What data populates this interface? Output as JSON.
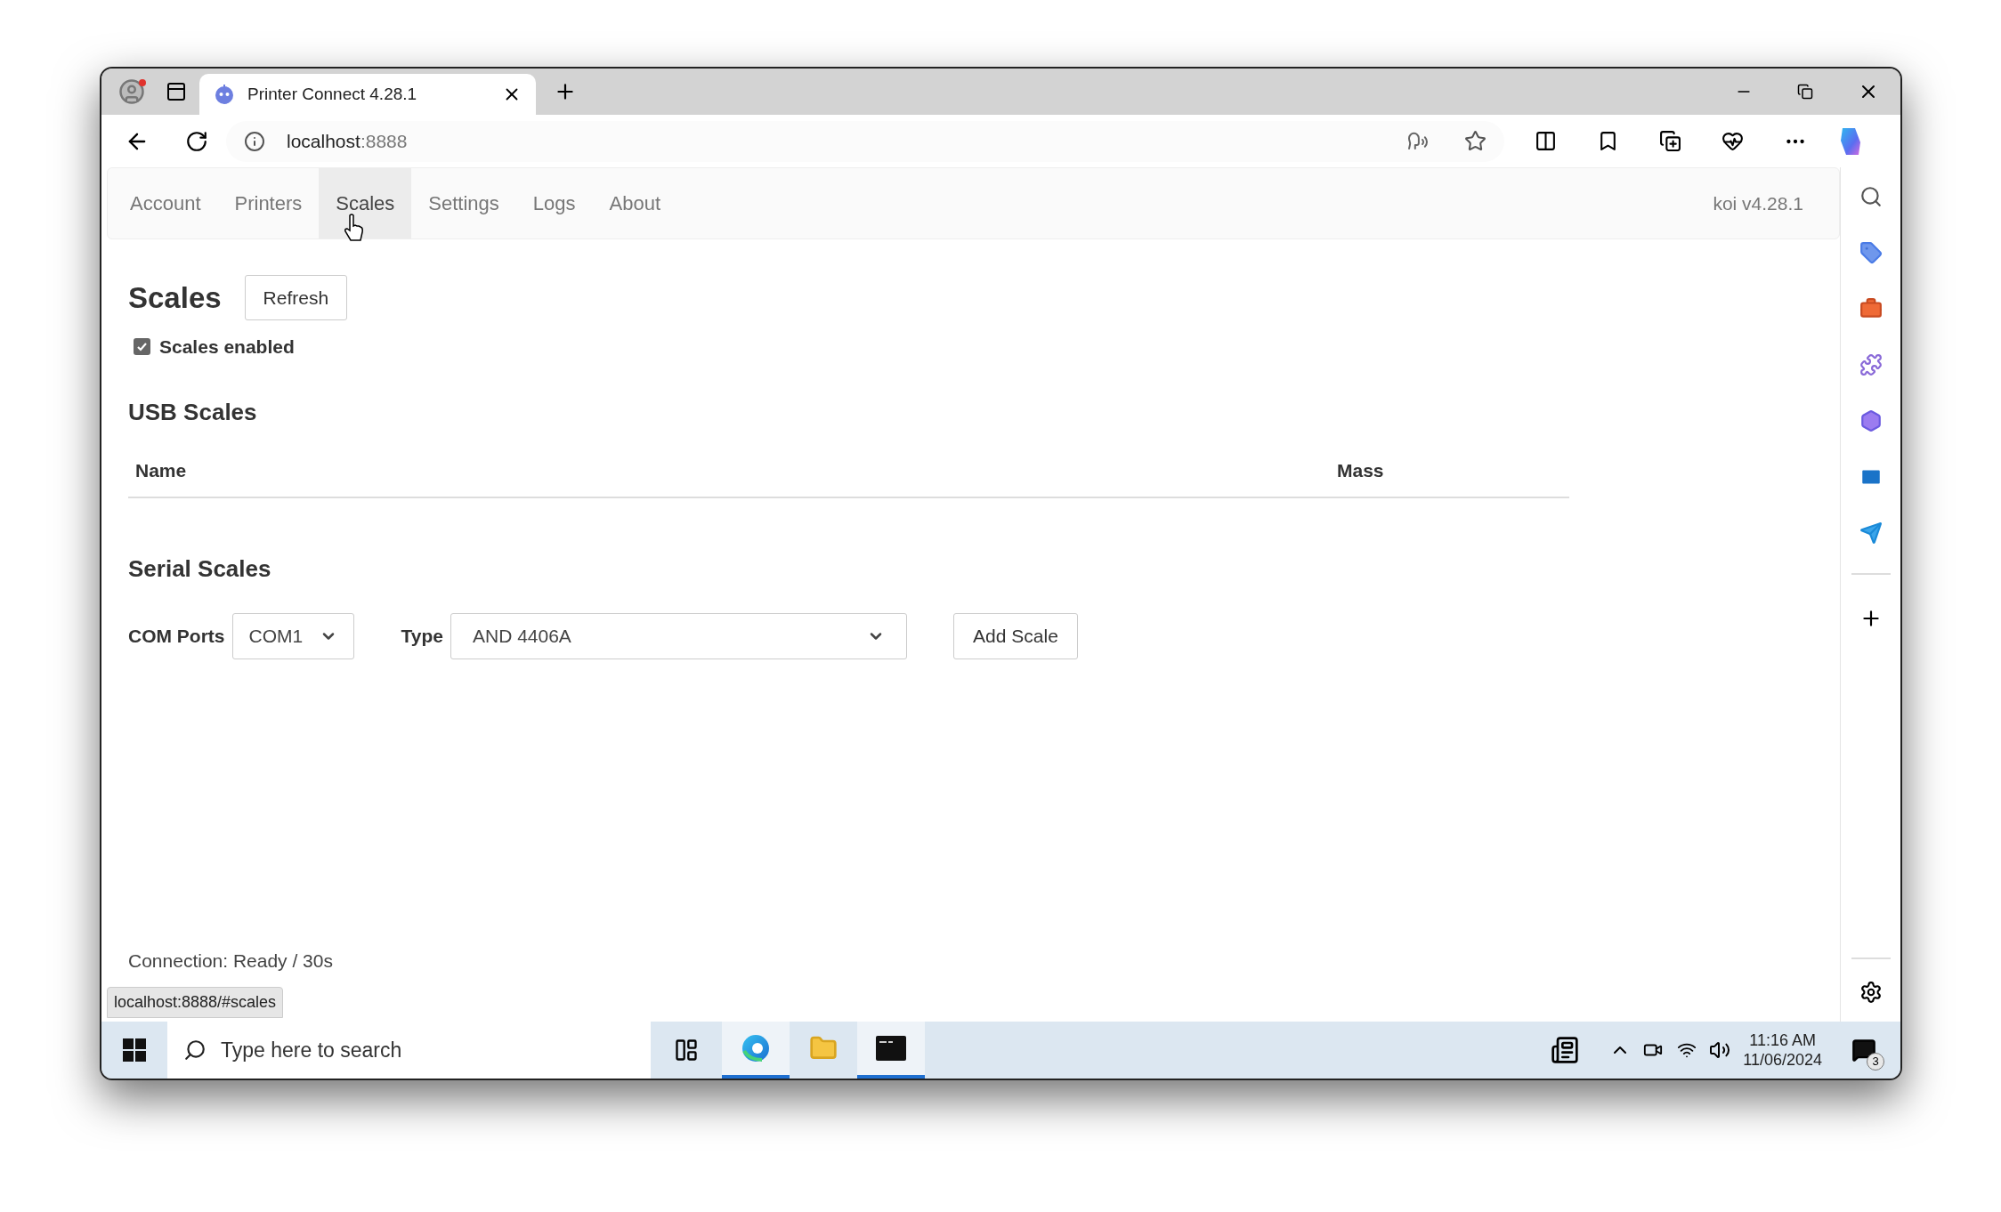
{
  "browser": {
    "tab_title": "Printer Connect 4.28.1",
    "address_host": "localhost",
    "address_port": ":8888",
    "status_url": "localhost:8888/#scales"
  },
  "nav": {
    "tabs": [
      {
        "label": "Account",
        "selected": false
      },
      {
        "label": "Printers",
        "selected": false
      },
      {
        "label": "Scales",
        "selected": true
      },
      {
        "label": "Settings",
        "selected": false
      },
      {
        "label": "Logs",
        "selected": false
      },
      {
        "label": "About",
        "selected": false
      }
    ],
    "version": "koi v4.28.1"
  },
  "page": {
    "title": "Scales",
    "refresh_button": "Refresh",
    "enabled": {
      "label": "Scales enabled",
      "checked": true
    },
    "usb": {
      "title": "USB Scales",
      "columns": [
        "Name",
        "Mass"
      ]
    },
    "serial": {
      "title": "Serial Scales",
      "com_label": "COM Ports",
      "com_value": "COM1",
      "type_label": "Type",
      "type_value": "AND 4406A",
      "add_button": "Add Scale"
    },
    "connection": "Connection: Ready / 30s"
  },
  "taskbar": {
    "search_placeholder": "Type here to search",
    "apps": [
      {
        "kind": "edge",
        "active": true
      },
      {
        "kind": "folder",
        "active": false
      },
      {
        "kind": "terminal",
        "active": true
      }
    ],
    "time": "11:16 AM",
    "date": "11/06/2024",
    "notifications": "3"
  }
}
